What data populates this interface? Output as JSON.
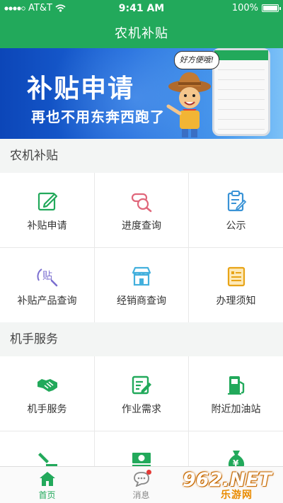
{
  "status_bar": {
    "carrier": "AT&T",
    "time": "9:41 AM",
    "battery": "100%"
  },
  "header": {
    "title": "农机补贴"
  },
  "banner": {
    "headline": "补贴申请",
    "subline": "再也不用东奔西跑了",
    "bubble": "好方便哦!"
  },
  "sections": [
    {
      "title": "农机补贴",
      "items": [
        {
          "label": "补贴申请",
          "icon": "edit-icon"
        },
        {
          "label": "进度查询",
          "icon": "progress-search-icon"
        },
        {
          "label": "公示",
          "icon": "clipboard-icon"
        },
        {
          "label": "补贴产品查询",
          "icon": "subsidy-search-icon"
        },
        {
          "label": "经销商查询",
          "icon": "store-icon"
        },
        {
          "label": "办理须知",
          "icon": "notice-icon"
        }
      ]
    },
    {
      "title": "机手服务",
      "items": [
        {
          "label": "机手服务",
          "icon": "handshake-icon"
        },
        {
          "label": "作业需求",
          "icon": "form-edit-icon"
        },
        {
          "label": "附近加油站",
          "icon": "fuel-pump-icon"
        },
        {
          "label": "",
          "icon": "tool-icon"
        },
        {
          "label": "",
          "icon": "cash-icon"
        },
        {
          "label": "",
          "icon": "money-bag-icon"
        }
      ]
    }
  ],
  "tabbar": [
    {
      "label": "首页",
      "icon": "home-icon",
      "active": true
    },
    {
      "label": "消息",
      "icon": "message-icon",
      "badge": true
    },
    {
      "label": "",
      "icon": "profile-icon"
    }
  ],
  "watermark": {
    "number": "962.NET",
    "site": "乐游网"
  },
  "colors": {
    "primary": "#22a95b",
    "background": "#f3f5f4",
    "badge": "#e53935"
  }
}
